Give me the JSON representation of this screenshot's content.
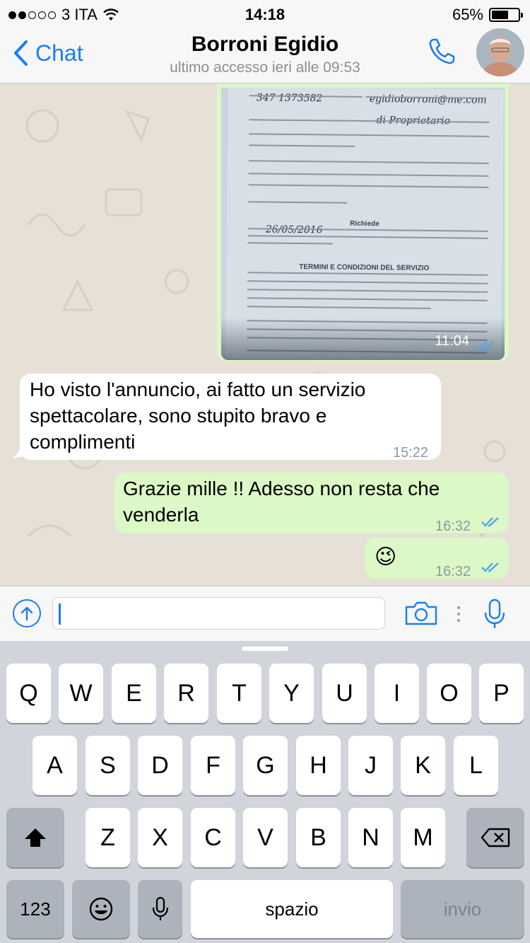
{
  "status_bar": {
    "carrier": "3 ITA",
    "time": "14:18",
    "battery": "65%",
    "battery_level": 0.65,
    "signal_bars_filled": 2,
    "signal_bars_total": 5
  },
  "nav": {
    "back_label": "Chat",
    "contact_name": "Borroni Egidio",
    "last_seen": "ultimo accesso ieri alle 09:53"
  },
  "document_image": {
    "phone": "347 1373582",
    "email": "egidioborroni@me.com",
    "role_handwritten": "di Proprietario",
    "date": "26/05/2016",
    "heading_request": "Richiede",
    "heading_terms": "TERMINI E CONDIZIONI DEL SERVIZIO",
    "time": "11:04"
  },
  "messages": [
    {
      "direction": "in",
      "text": "Ho visto l'annuncio, ai fatto un servizio spettacolare, sono stupito bravo e complimenti",
      "time": "15:22"
    },
    {
      "direction": "out",
      "text": "Grazie mille !! Adesso non resta che venderla",
      "time": "16:32"
    },
    {
      "direction": "out",
      "text": "😉",
      "time": "16:32"
    }
  ],
  "keyboard": {
    "row1": [
      "Q",
      "W",
      "E",
      "R",
      "T",
      "Y",
      "U",
      "I",
      "O",
      "P"
    ],
    "row2": [
      "A",
      "S",
      "D",
      "F",
      "G",
      "H",
      "J",
      "K",
      "L"
    ],
    "row3": [
      "Z",
      "X",
      "C",
      "V",
      "B",
      "N",
      "M"
    ],
    "numbers": "123",
    "space": "spazio",
    "return": "invio"
  },
  "colors": {
    "accent": "#1a7ef5",
    "outgoing_bubble": "#dcf8c6",
    "incoming_bubble": "#ffffff",
    "read_ticks": "#4fa5e8",
    "wallpaper": "#e6e0d7"
  }
}
